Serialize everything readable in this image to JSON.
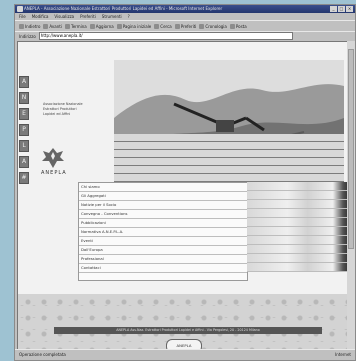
{
  "window": {
    "title": "ANEPLA - Associazione Nazionale Estrattori Produttori Lapidei ed Affini - Microsoft Internet Explorer",
    "buttons": [
      "_",
      "□",
      "×"
    ]
  },
  "menubar": {
    "items": [
      "File",
      "Modifica",
      "Visualizza",
      "Preferiti",
      "Strumenti",
      "?"
    ]
  },
  "toolbar": {
    "items": [
      {
        "label": "Indietro",
        "icon": "back-arrow-icon"
      },
      {
        "label": "Avanti",
        "icon": "forward-arrow-icon"
      },
      {
        "label": "Termina",
        "icon": "stop-icon"
      },
      {
        "label": "Aggiorna",
        "icon": "refresh-icon"
      },
      {
        "label": "Pagina iniziale",
        "icon": "home-icon"
      },
      {
        "label": "Cerca",
        "icon": "search-icon"
      },
      {
        "label": "Preferiti",
        "icon": "favorites-icon"
      },
      {
        "label": "Cronologia",
        "icon": "history-icon"
      },
      {
        "label": "Posta",
        "icon": "mail-icon"
      }
    ]
  },
  "addressbar": {
    "label": "Indirizzo",
    "value": "http://www.anepla.it/"
  },
  "page": {
    "side_icons": [
      "A",
      "N",
      "E",
      "P",
      "L",
      "A",
      "#"
    ],
    "org": {
      "line1": "Associazione Nazionale",
      "line2": "Estrattori Produttori",
      "line3": "Lapidei ed Affini"
    },
    "logo_text": "ANEPLA",
    "menu": [
      "Chi siamo",
      "Gli Aggregati",
      "Notizie per il Socio",
      "Convegno - Conventions",
      "Pubblicazioni",
      "Normativa A.N.E.P.L.A.",
      "Eventi",
      "Dall'Europa",
      "Professional",
      "Contattaci"
    ],
    "footer_text": "ANEPLA Ass.Naz. Estrattori Produttori Lapidei e Affini - Via Pergolesi, 20 - 20124 Milano",
    "badge": "ANEPLA"
  },
  "status": {
    "left": "Operazione completata",
    "right": "Internet"
  }
}
